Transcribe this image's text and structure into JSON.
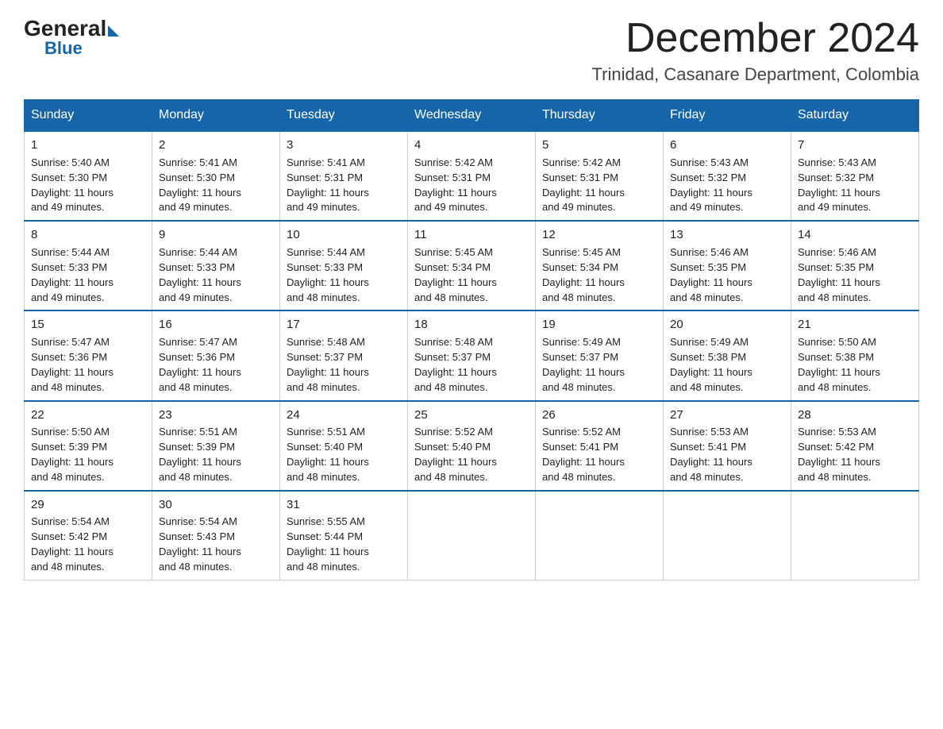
{
  "logo": {
    "general": "General",
    "blue": "Blue"
  },
  "title": "December 2024",
  "subtitle": "Trinidad, Casanare Department, Colombia",
  "days": [
    "Sunday",
    "Monday",
    "Tuesday",
    "Wednesday",
    "Thursday",
    "Friday",
    "Saturday"
  ],
  "weeks": [
    [
      {
        "num": "1",
        "sunrise": "5:40 AM",
        "sunset": "5:30 PM",
        "daylight": "11 hours and 49 minutes."
      },
      {
        "num": "2",
        "sunrise": "5:41 AM",
        "sunset": "5:30 PM",
        "daylight": "11 hours and 49 minutes."
      },
      {
        "num": "3",
        "sunrise": "5:41 AM",
        "sunset": "5:31 PM",
        "daylight": "11 hours and 49 minutes."
      },
      {
        "num": "4",
        "sunrise": "5:42 AM",
        "sunset": "5:31 PM",
        "daylight": "11 hours and 49 minutes."
      },
      {
        "num": "5",
        "sunrise": "5:42 AM",
        "sunset": "5:31 PM",
        "daylight": "11 hours and 49 minutes."
      },
      {
        "num": "6",
        "sunrise": "5:43 AM",
        "sunset": "5:32 PM",
        "daylight": "11 hours and 49 minutes."
      },
      {
        "num": "7",
        "sunrise": "5:43 AM",
        "sunset": "5:32 PM",
        "daylight": "11 hours and 49 minutes."
      }
    ],
    [
      {
        "num": "8",
        "sunrise": "5:44 AM",
        "sunset": "5:33 PM",
        "daylight": "11 hours and 49 minutes."
      },
      {
        "num": "9",
        "sunrise": "5:44 AM",
        "sunset": "5:33 PM",
        "daylight": "11 hours and 49 minutes."
      },
      {
        "num": "10",
        "sunrise": "5:44 AM",
        "sunset": "5:33 PM",
        "daylight": "11 hours and 48 minutes."
      },
      {
        "num": "11",
        "sunrise": "5:45 AM",
        "sunset": "5:34 PM",
        "daylight": "11 hours and 48 minutes."
      },
      {
        "num": "12",
        "sunrise": "5:45 AM",
        "sunset": "5:34 PM",
        "daylight": "11 hours and 48 minutes."
      },
      {
        "num": "13",
        "sunrise": "5:46 AM",
        "sunset": "5:35 PM",
        "daylight": "11 hours and 48 minutes."
      },
      {
        "num": "14",
        "sunrise": "5:46 AM",
        "sunset": "5:35 PM",
        "daylight": "11 hours and 48 minutes."
      }
    ],
    [
      {
        "num": "15",
        "sunrise": "5:47 AM",
        "sunset": "5:36 PM",
        "daylight": "11 hours and 48 minutes."
      },
      {
        "num": "16",
        "sunrise": "5:47 AM",
        "sunset": "5:36 PM",
        "daylight": "11 hours and 48 minutes."
      },
      {
        "num": "17",
        "sunrise": "5:48 AM",
        "sunset": "5:37 PM",
        "daylight": "11 hours and 48 minutes."
      },
      {
        "num": "18",
        "sunrise": "5:48 AM",
        "sunset": "5:37 PM",
        "daylight": "11 hours and 48 minutes."
      },
      {
        "num": "19",
        "sunrise": "5:49 AM",
        "sunset": "5:37 PM",
        "daylight": "11 hours and 48 minutes."
      },
      {
        "num": "20",
        "sunrise": "5:49 AM",
        "sunset": "5:38 PM",
        "daylight": "11 hours and 48 minutes."
      },
      {
        "num": "21",
        "sunrise": "5:50 AM",
        "sunset": "5:38 PM",
        "daylight": "11 hours and 48 minutes."
      }
    ],
    [
      {
        "num": "22",
        "sunrise": "5:50 AM",
        "sunset": "5:39 PM",
        "daylight": "11 hours and 48 minutes."
      },
      {
        "num": "23",
        "sunrise": "5:51 AM",
        "sunset": "5:39 PM",
        "daylight": "11 hours and 48 minutes."
      },
      {
        "num": "24",
        "sunrise": "5:51 AM",
        "sunset": "5:40 PM",
        "daylight": "11 hours and 48 minutes."
      },
      {
        "num": "25",
        "sunrise": "5:52 AM",
        "sunset": "5:40 PM",
        "daylight": "11 hours and 48 minutes."
      },
      {
        "num": "26",
        "sunrise": "5:52 AM",
        "sunset": "5:41 PM",
        "daylight": "11 hours and 48 minutes."
      },
      {
        "num": "27",
        "sunrise": "5:53 AM",
        "sunset": "5:41 PM",
        "daylight": "11 hours and 48 minutes."
      },
      {
        "num": "28",
        "sunrise": "5:53 AM",
        "sunset": "5:42 PM",
        "daylight": "11 hours and 48 minutes."
      }
    ],
    [
      {
        "num": "29",
        "sunrise": "5:54 AM",
        "sunset": "5:42 PM",
        "daylight": "11 hours and 48 minutes."
      },
      {
        "num": "30",
        "sunrise": "5:54 AM",
        "sunset": "5:43 PM",
        "daylight": "11 hours and 48 minutes."
      },
      {
        "num": "31",
        "sunrise": "5:55 AM",
        "sunset": "5:44 PM",
        "daylight": "11 hours and 48 minutes."
      },
      null,
      null,
      null,
      null
    ]
  ],
  "labels": {
    "sunrise": "Sunrise:",
    "sunset": "Sunset:",
    "daylight": "Daylight:"
  }
}
